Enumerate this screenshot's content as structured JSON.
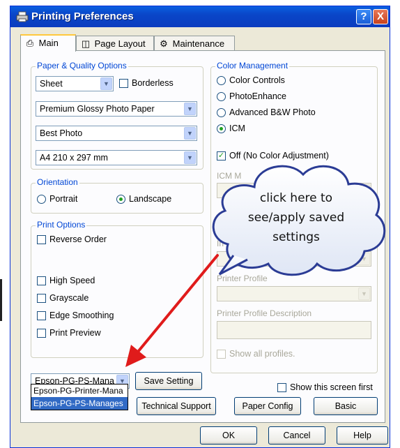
{
  "window": {
    "title": "Printing Preferences",
    "help_label": "?",
    "close_label": "X"
  },
  "tabs": [
    {
      "label": "Main",
      "icon": "printer-icon"
    },
    {
      "label": "Page Layout",
      "icon": "page-layout-icon"
    },
    {
      "label": "Maintenance",
      "icon": "maintenance-icon"
    }
  ],
  "paper_quality": {
    "title": "Paper & Quality Options",
    "source": "Sheet",
    "borderless_label": "Borderless",
    "media_type": "Premium Glossy Photo Paper",
    "quality": "Best Photo",
    "size": "A4 210 x 297 mm"
  },
  "orientation": {
    "title": "Orientation",
    "portrait": "Portrait",
    "landscape": "Landscape",
    "selected": "Landscape"
  },
  "print_options": {
    "title": "Print Options",
    "reverse_order": "Reverse Order",
    "high_speed": "High Speed",
    "grayscale": "Grayscale",
    "edge_smoothing": "Edge Smoothing",
    "print_preview": "Print Preview"
  },
  "color_management": {
    "title": "Color Management",
    "options": [
      "Color Controls",
      "PhotoEnhance",
      "Advanced B&W Photo",
      "ICM"
    ],
    "selected": "ICM",
    "off_label": "Off (No Color Adjustment)",
    "icm_mode_label": "ICM M",
    "partial_label": "In",
    "printer_profile_label": "Printer Profile",
    "printer_profile_desc_label": "Printer Profile Description",
    "show_all_profiles": "Show all profiles."
  },
  "saved_settings": {
    "current": "Epson-PG-PS-Mana",
    "list": [
      "Epson-PG-Printer-Mana",
      "Epson-PG-PS-Manages"
    ],
    "save_button": "Save Setting"
  },
  "bottom_row": {
    "show_screen_first": "Show this screen first",
    "technical_support": "Technical Support",
    "paper_config": "Paper Config",
    "basic": "Basic"
  },
  "dialog_buttons": {
    "ok": "OK",
    "cancel": "Cancel",
    "help": "Help"
  },
  "annotation": {
    "callout_line1": "click here to",
    "callout_line2": "see/apply saved",
    "callout_line3": "settings",
    "arrow_color": "#e01b1b"
  }
}
